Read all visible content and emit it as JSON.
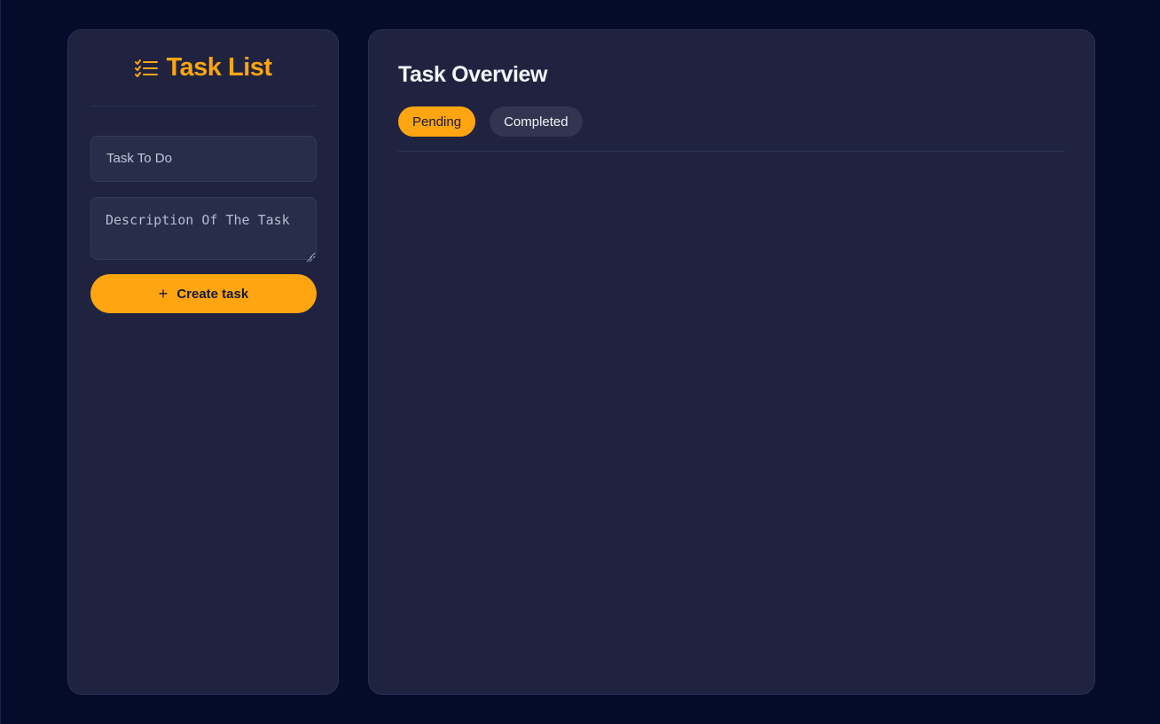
{
  "sidebar": {
    "title": "Task List",
    "task_input": {
      "placeholder": "Task To Do",
      "value": ""
    },
    "description_input": {
      "placeholder": "Description Of The Task",
      "value": ""
    },
    "create_button": {
      "label": "Create task",
      "icon": "plus-icon"
    }
  },
  "main": {
    "title": "Task Overview",
    "tabs": [
      {
        "label": "Pending",
        "active": true
      },
      {
        "label": "Completed",
        "active": false
      }
    ]
  },
  "colors": {
    "background": "#050b2a",
    "panel": "#1f2340",
    "accent": "#ffa50f",
    "input_bg": "#282d4a",
    "inactive_tab": "#31354f"
  }
}
